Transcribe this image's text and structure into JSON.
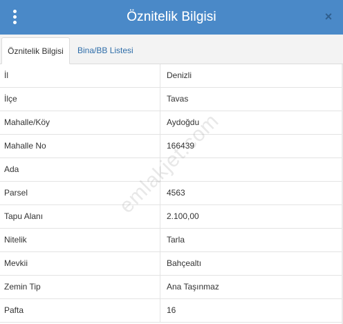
{
  "window": {
    "title": "Öznitelik Bilgisi",
    "close_glyph": "×",
    "menu_icon": "vertical-dots-icon",
    "close_icon": "close-icon"
  },
  "tabs": [
    {
      "label": "Öznitelik Bilgisi",
      "active": true
    },
    {
      "label": "Bina/BB Listesi",
      "active": false
    }
  ],
  "attributes": [
    {
      "key": "İl",
      "value": "Denizli"
    },
    {
      "key": "İlçe",
      "value": "Tavas"
    },
    {
      "key": "Mahalle/Köy",
      "value": "Aydoğdu"
    },
    {
      "key": "Mahalle No",
      "value": "166439"
    },
    {
      "key": "Ada",
      "value": ""
    },
    {
      "key": "Parsel",
      "value": "4563"
    },
    {
      "key": "Tapu Alanı",
      "value": "2.100,00"
    },
    {
      "key": "Nitelik",
      "value": "Tarla"
    },
    {
      "key": "Mevkii",
      "value": "Bahçealtı"
    },
    {
      "key": "Zemin Tip",
      "value": "Ana Taşınmaz"
    },
    {
      "key": "Pafta",
      "value": "16"
    }
  ],
  "watermark": "emlakjet.com",
  "colors": {
    "header": "#4a89c8",
    "tab_link": "#2d6ca8"
  }
}
